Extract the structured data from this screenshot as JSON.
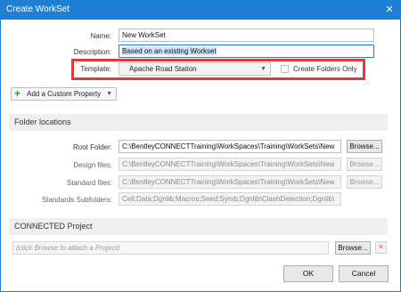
{
  "window": {
    "title": "Create WorkSet",
    "close_glyph": "✕"
  },
  "form": {
    "name_label": "Name:",
    "name_value": "New WorkSet",
    "description_label": "Description:",
    "description_value": "Based on an existing Workset",
    "template_label": "Template:",
    "template_value": "Apache Road Station",
    "create_folders_label": "Create Folders Only",
    "create_folders_checked": false,
    "add_property_label": "Add a Custom Property"
  },
  "folder_locations": {
    "heading": "Folder locations",
    "rows": [
      {
        "label": "Root Folder:",
        "value": "C:\\BentleyCONNECTTraining\\WorkSpaces\\Training\\WorkSets\\New",
        "button": "Browse...",
        "enabled": true
      },
      {
        "label": "Design files:",
        "value": "C:\\BentleyCONNECTTraining\\WorkSpaces\\Training\\WorkSets\\New",
        "button": "Browse...",
        "enabled": false
      },
      {
        "label": "Standard files:",
        "value": "C:\\BentleyCONNECTTraining\\WorkSpaces\\Training\\WorkSets\\New",
        "button": "Browse...",
        "enabled": false
      },
      {
        "label": "Standards Subfolders:",
        "value": "Cell;Data;Dgnlib;Macros;Seed;Symb;Dgnlib\\ClashDetection;Dgnlib\\",
        "enabled": false
      }
    ]
  },
  "connected": {
    "heading": "CONNECTED Project",
    "placeholder": "(click Browse to attach a Project)",
    "browse_label": "Browse...",
    "clear_glyph": "✕"
  },
  "footer": {
    "ok_label": "OK",
    "cancel_label": "Cancel"
  },
  "icons": {
    "add": "plus-icon",
    "dropdown": "chevron-down-icon",
    "close": "close-icon"
  },
  "colors": {
    "accent": "#1e7fd4",
    "highlight": "#e03a3a",
    "add_icon": "#2e9e2e"
  }
}
